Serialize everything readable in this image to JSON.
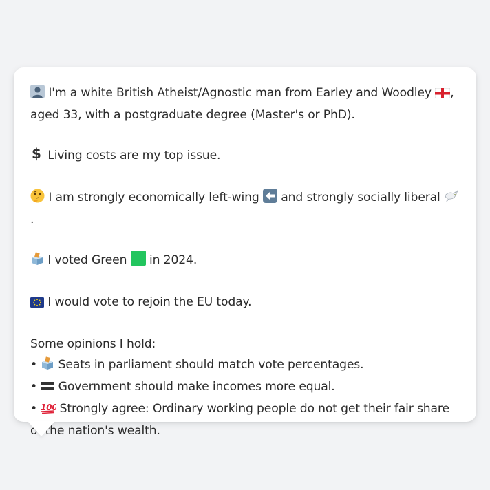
{
  "profile": {
    "line1_icon": "person-silhouette-icon",
    "line1_text_a": "I'm a white British Atheist/Agnostic man from Earley and Woodley",
    "line1_flag": "england-flag-icon",
    "line1_text_b": ",",
    "line1_text_c": "aged 33, with a postgraduate degree (Master's or PhD).",
    "issue_icon": "dollar-icon",
    "issue_text": "Living costs are my top issue.",
    "ideology_icon": "thinking-face-icon",
    "ideology_text_a": "I am strongly economically left-wing",
    "ideology_left_icon": "left-arrow-icon",
    "ideology_text_b": "and strongly socially liberal",
    "ideology_dove_icon": "dove-icon",
    "ideology_text_c": ".",
    "vote_icon": "ballot-box-icon",
    "vote_text_a": "I voted Green",
    "vote_square_icon": "green-square-icon",
    "vote_text_b": "in 2024.",
    "eu_icon": "eu-flag-icon",
    "eu_text": "I would vote to rejoin the EU today.",
    "opinions_heading": "Some opinions I hold:",
    "opinions": [
      {
        "bullet": "•",
        "icon": "ballot-box-icon",
        "text": "Seats in parliament should match vote percentages."
      },
      {
        "bullet": "•",
        "icon": "equals-icon",
        "text": "Government should make incomes more equal."
      },
      {
        "bullet": "•",
        "icon": "hundred-points-icon",
        "text": "Strongly agree: Ordinary working people do not get their fair share of the nation's wealth."
      }
    ]
  },
  "colors": {
    "background": "#f2f3f5",
    "bubble": "#ffffff",
    "text": "#2b2b2b",
    "green_square": "#22c55e",
    "eu_blue": "#1f3a8a"
  }
}
